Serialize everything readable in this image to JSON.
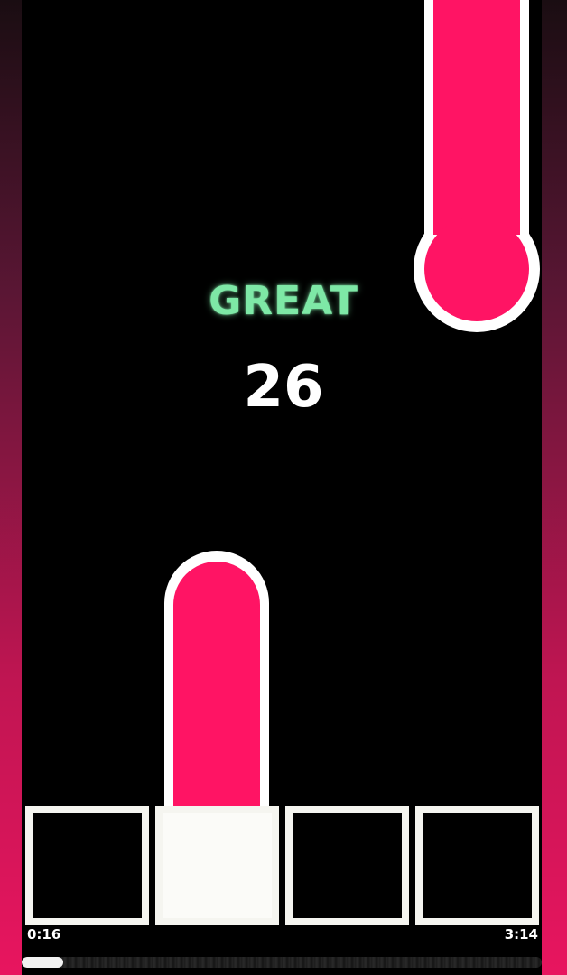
{
  "game": {
    "rating": "GREAT",
    "score": "26"
  },
  "notes": {
    "color": "#ff1464",
    "outline": "#ffffff"
  },
  "lanes": [
    {
      "pressed": false
    },
    {
      "pressed": true
    },
    {
      "pressed": false
    },
    {
      "pressed": false
    }
  ],
  "playback": {
    "elapsed": "0:16",
    "total": "3:14",
    "progress": 0.08
  }
}
